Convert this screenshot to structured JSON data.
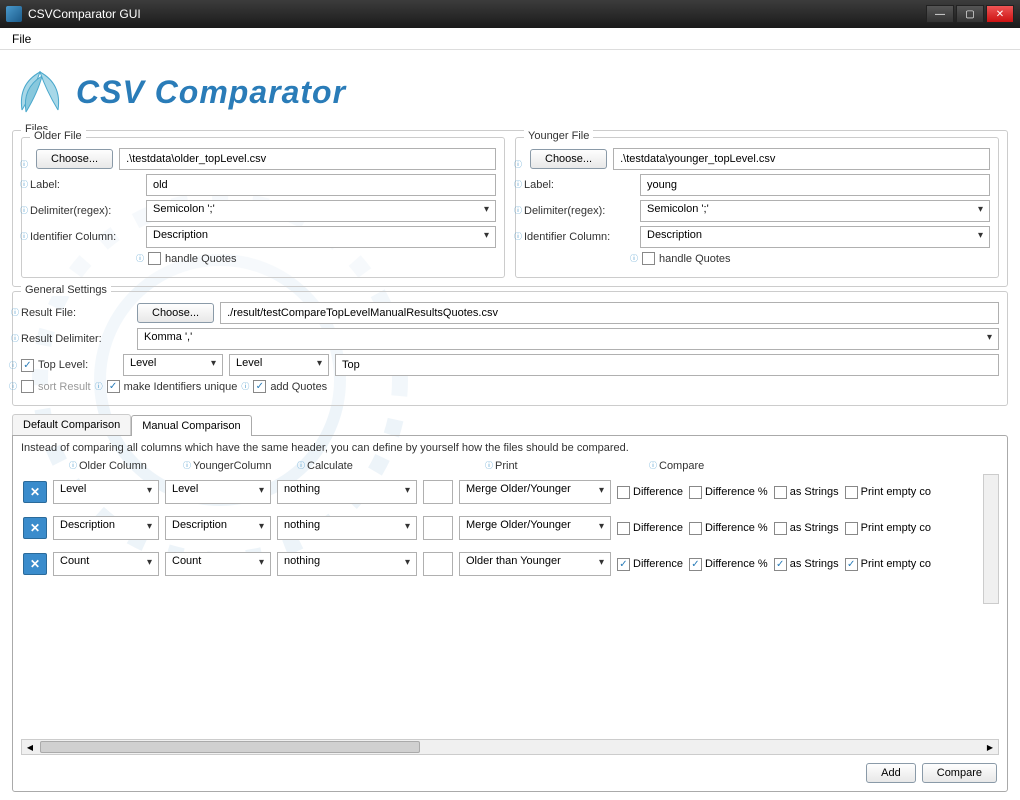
{
  "window": {
    "title": "CSVComparator GUI"
  },
  "menu": {
    "file": "File"
  },
  "logo": {
    "text": "CSV Comparator"
  },
  "files": {
    "legend": "Files",
    "older": {
      "legend": "Older File",
      "choose": "Choose...",
      "path": ".\\testdata\\older_topLevel.csv",
      "label_lbl": "Label:",
      "label_val": "old",
      "delim_lbl": "Delimiter(regex):",
      "delim_val": "Semicolon ';'",
      "idcol_lbl": "Identifier Column:",
      "idcol_val": "Description",
      "hq_lbl": "handle Quotes",
      "hq_checked": false
    },
    "younger": {
      "legend": "Younger File",
      "choose": "Choose...",
      "path": ".\\testdata\\younger_topLevel.csv",
      "label_lbl": "Label:",
      "label_val": "young",
      "delim_lbl": "Delimiter(regex):",
      "delim_val": "Semicolon ';'",
      "idcol_lbl": "Identifier Column:",
      "idcol_val": "Description",
      "hq_lbl": "handle Quotes",
      "hq_checked": false
    }
  },
  "general": {
    "legend": "General Settings",
    "result_file_lbl": "Result File:",
    "result_choose": "Choose...",
    "result_path": "./result/testCompareTopLevelManualResultsQuotes.csv",
    "result_delim_lbl": "Result Delimiter:",
    "result_delim_val": "Komma ','",
    "toplevel_lbl": "Top Level:",
    "toplevel_checked": true,
    "toplevel_combo1": "Level",
    "toplevel_combo2": "Level",
    "toplevel_txt": "Top",
    "sort_lbl": "sort Result",
    "sort_checked": false,
    "unique_lbl": "make Identifiers unique",
    "unique_checked": true,
    "addq_lbl": "add Quotes",
    "addq_checked": true
  },
  "tabs": {
    "default": "Default Comparison",
    "manual": "Manual Comparison"
  },
  "manual": {
    "desc": "Instead of comparing all columns which have the same header, you can define by yourself how the files should be compared.",
    "headers": {
      "older": "Older Column",
      "younger": "YoungerColumn",
      "calc": "Calculate",
      "print": "Print",
      "compare": "Compare"
    },
    "rows": [
      {
        "older": "Level",
        "younger": "Level",
        "calc": "nothing",
        "print": "Merge Older/Younger",
        "diff": false,
        "diffp": false,
        "str": false,
        "empty": false
      },
      {
        "older": "Description",
        "younger": "Description",
        "calc": "nothing",
        "print": "Merge Older/Younger",
        "diff": false,
        "diffp": false,
        "str": false,
        "empty": false
      },
      {
        "older": "Count",
        "younger": "Count",
        "calc": "nothing",
        "print": "Older than Younger",
        "diff": true,
        "diffp": true,
        "str": true,
        "empty": true
      }
    ],
    "check_labels": {
      "diff": "Difference",
      "diffp": "Difference %",
      "str": "as Strings",
      "empty": "Print empty co"
    }
  },
  "footer": {
    "add": "Add",
    "compare": "Compare"
  }
}
